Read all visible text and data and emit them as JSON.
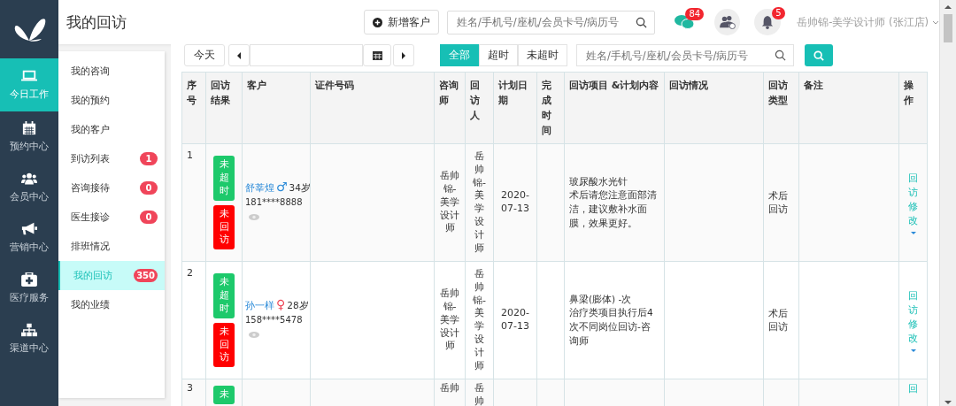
{
  "header": {
    "title": "我的回访",
    "add_button": "新增客户",
    "search": {
      "placeholder": "姓名/手机号/座机/会员卡号/病历号"
    },
    "chat_badge": "84",
    "bell_badge": "5",
    "user": "岳帅锦-美学设计师 (张江店)"
  },
  "rail": [
    {
      "label": "今日工作",
      "kind": "laptop",
      "selected": true
    },
    {
      "label": "预约中心",
      "kind": "calendar",
      "selected": false
    },
    {
      "label": "会员中心",
      "kind": "users",
      "selected": false
    },
    {
      "label": "营销中心",
      "kind": "megaphone",
      "selected": false
    },
    {
      "label": "医疗服务",
      "kind": "medkit",
      "selected": false
    },
    {
      "label": "渠道中心",
      "kind": "sitemap",
      "selected": false
    }
  ],
  "submenu": [
    {
      "label": "我的咨询",
      "selected": false
    },
    {
      "label": "我的预约",
      "selected": false
    },
    {
      "label": "我的客户",
      "selected": false
    },
    {
      "label": "到访列表",
      "badge": "1",
      "selected": false
    },
    {
      "label": "咨询接待",
      "badge": "0",
      "selected": false
    },
    {
      "label": "医生接诊",
      "badge": "0",
      "selected": false
    },
    {
      "label": "排班情况",
      "selected": false
    },
    {
      "label": "我的回访",
      "badge": "350",
      "selected": true
    },
    {
      "label": "我的业绩",
      "selected": false
    }
  ],
  "toolbar": {
    "today": "今天",
    "filters": [
      {
        "label": "全部",
        "selected": true
      },
      {
        "label": "超时",
        "selected": false
      },
      {
        "label": "未超时",
        "selected": false
      }
    ],
    "search": {
      "placeholder": "姓名/手机号/座机/会员卡号/病历号"
    }
  },
  "table": {
    "columns": [
      "序号",
      "回访结果",
      "客户",
      "证件号码",
      "咨询师",
      "回访人",
      "计划日期",
      "完成时间",
      "回访项目 &计划内容",
      "回访情况",
      "回访类型",
      "备注",
      "操作"
    ],
    "rows": [
      {
        "seq": "1",
        "results": [
          {
            "text": "未超时",
            "kind": "ok"
          },
          {
            "text": "未回访",
            "kind": "pending"
          }
        ],
        "name": "舒莘煌",
        "gender_symbol": "♂",
        "color": "#2a8ad8",
        "age": "34岁",
        "phone": "181****8888",
        "consultant": "岳帅锦-美学设计师",
        "visitor": "岳帅锦-美学设计师",
        "date": "2020-07-13",
        "plan": [
          "玻尿酸水光针",
          "术后请您注意面部清洁，建议敷补水面膜，效果更好。"
        ],
        "type": "术后回访",
        "action": "回访修改"
      },
      {
        "seq": "2",
        "results": [
          {
            "text": "未超时",
            "kind": "ok"
          },
          {
            "text": "未回访",
            "kind": "pending"
          }
        ],
        "name": "孙一样",
        "gender_symbol": "♀",
        "color": "#ee4455",
        "age": "28岁",
        "phone": "158****5478",
        "consultant": "岳帅锦-美学设计师",
        "visitor": "岳帅锦-美学设计师",
        "date": "2020-07-13",
        "plan": [
          "鼻梁(膨体) -次",
          "治疗类项目执行后4次不同岗位回访-咨询师"
        ],
        "type": "术后回访",
        "action": "回访修改"
      },
      {
        "seq": "3",
        "results": [
          {
            "text": "未",
            "kind": "ok"
          }
        ],
        "consultant": "岳帅",
        "visitor": "岳帅",
        "action": "回"
      }
    ]
  }
}
